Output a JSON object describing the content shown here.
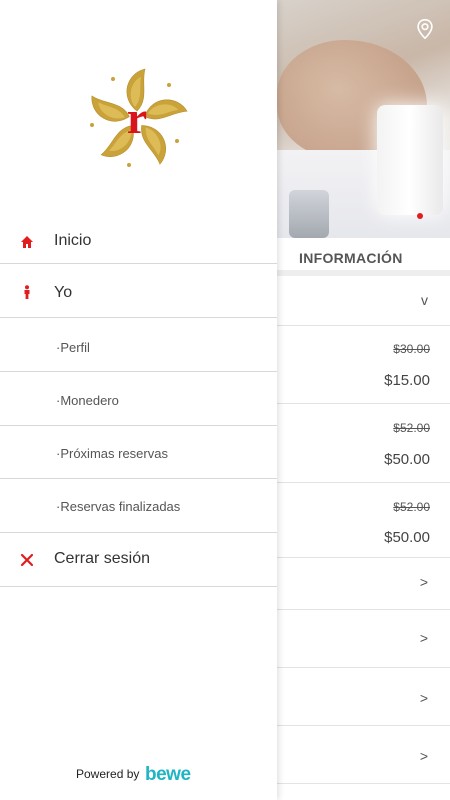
{
  "background": {
    "hero_image": "massage-spa-photo",
    "info_title": "INFORMACIÓN",
    "collapse_chevron": "v",
    "prices": [
      {
        "old": "$30.00",
        "new": "$15.00"
      },
      {
        "old": "$52.00",
        "new": "$50.00"
      },
      {
        "old": "$52.00",
        "new": "$50.00"
      }
    ],
    "row_chevron": ">"
  },
  "drawer": {
    "logo_letter": "r",
    "menu": [
      {
        "label": "Inicio",
        "icon": "home-icon"
      },
      {
        "label": "Yo",
        "icon": "person-icon"
      },
      {
        "label": "·Perfil"
      },
      {
        "label": "·Monedero"
      },
      {
        "label": "·Próximas reservas"
      },
      {
        "label": "·Reservas finalizadas"
      },
      {
        "label": "Cerrar sesión",
        "icon": "close-icon"
      }
    ],
    "footer": {
      "powered_by": "Powered by",
      "brand": "bewe"
    }
  },
  "colors": {
    "accent": "#e21d1d",
    "brand": "#1fb5c4",
    "gold": "#c9a23a"
  }
}
